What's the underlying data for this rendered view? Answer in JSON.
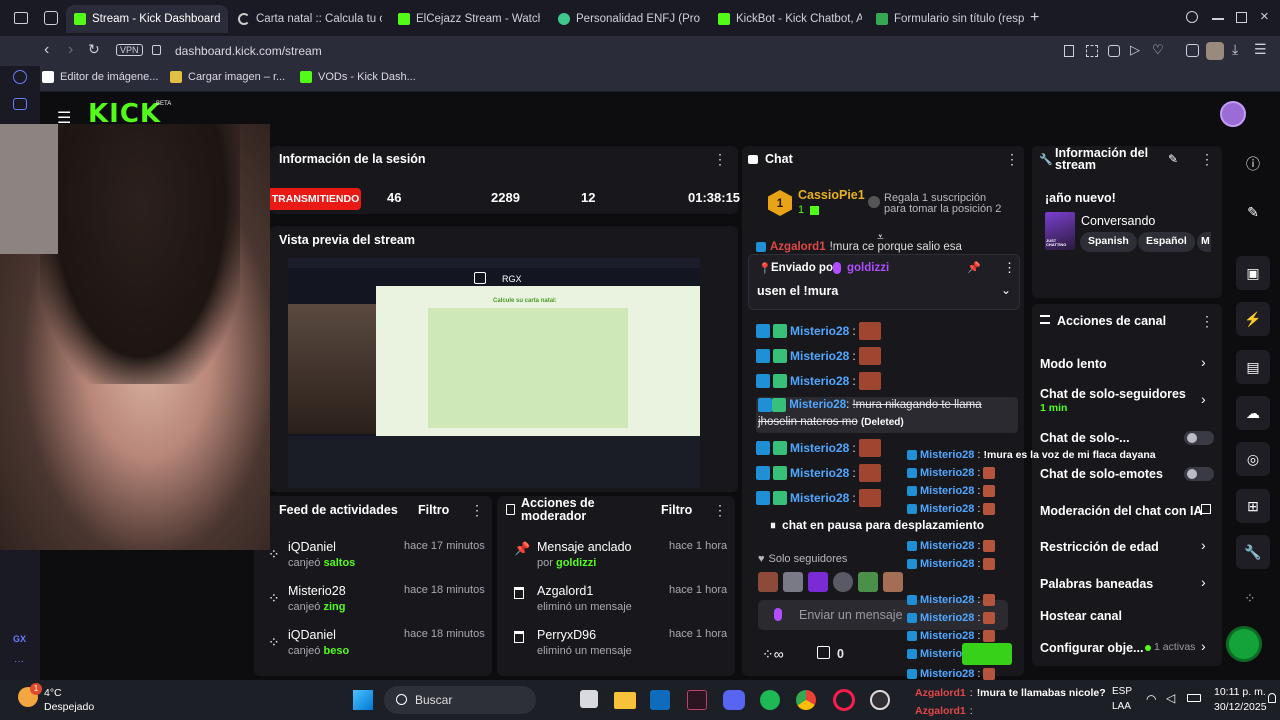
{
  "browser": {
    "tabs": [
      {
        "label": "Stream - Kick Dashboard",
        "active": true,
        "color": "#53fc18"
      },
      {
        "label": "Carta natal :: Calcula tu ca",
        "active": false,
        "color": "#cccccc"
      },
      {
        "label": "ElCejazz Stream - Watch L",
        "active": false,
        "color": "#53fc18"
      },
      {
        "label": "Personalidad ENFJ (Protag",
        "active": false,
        "color": "#3ec98d"
      },
      {
        "label": "KickBot - Kick Chatbot, AI",
        "active": false,
        "color": "#53fc18"
      },
      {
        "label": "Formulario sin título (respu",
        "active": false,
        "color": "#34a853"
      }
    ],
    "vpn": "VPN",
    "url": "dashboard.kick.com/stream",
    "bookmarks": [
      {
        "label": "Editor de imágene...",
        "color": "#ffffff"
      },
      {
        "label": "Cargar imagen – r...",
        "color": "#e0c040"
      },
      {
        "label": "VODs - Kick Dash...",
        "color": "#53fc18"
      }
    ]
  },
  "kick": {
    "logo": "KICK",
    "logo_sup": "BETA"
  },
  "session": {
    "title": "Información de la sesión",
    "status": "TRANSMITIENDO",
    "viewers": "46",
    "followers": "2289",
    "subs": "12",
    "uptime": "01:38:15"
  },
  "preview": {
    "title": "Vista previa del stream",
    "rgx": "RGX",
    "form_title": "Calcule su carta natal:"
  },
  "activity_feed": {
    "title": "Feed de actividades",
    "filter": "Filtro",
    "items": [
      {
        "name": "iQDaniel",
        "action": "canjeó",
        "reward": "saltos",
        "time": "hace 17 minutos"
      },
      {
        "name": "Misterio28",
        "action": "canjeó",
        "reward": "zing",
        "time": "hace 18 minutos"
      },
      {
        "name": "iQDaniel",
        "action": "canjeó",
        "reward": "beso",
        "time": "hace 18 minutos"
      }
    ]
  },
  "mod_actions": {
    "title": "Acciones de moderador",
    "filter": "Filtro",
    "items": [
      {
        "name": "Mensaje anclado",
        "sub_prefix": "por",
        "sub_user": "goldizzi",
        "time": "hace 1 hora",
        "icon": "pin-icon"
      },
      {
        "name": "Azgalord1",
        "sub": "eliminó un mensaje",
        "time": "hace 1 hora",
        "icon": "trash-icon"
      },
      {
        "name": "PerryxD96",
        "sub": "eliminó un mensaje",
        "time": "hace 1 hora",
        "icon": "trash-icon"
      }
    ]
  },
  "chat": {
    "title": "Chat",
    "top_user": "CassioPie1",
    "top_rank": "1",
    "top_count": "1",
    "gift_prompt_line1": "Regala 1 suscripción",
    "gift_prompt_line2": "para tomar la posición 2",
    "peek_name": "Azgalord1",
    "peek_text": "!mura ce porque salio esa",
    "pinned_by_label": "Enviado por",
    "pinned_by_user": "goldizzi",
    "pinned_text": "usen el !mura",
    "messages": [
      {
        "user": "Misterio28",
        "text": ""
      },
      {
        "user": "Misterio28",
        "text": ""
      },
      {
        "user": "Misterio28",
        "text": ""
      },
      {
        "user": "Misterio28",
        "text": "!mura nikagando te llama jhoselin nateros mo",
        "deleted": "(Deleted)"
      },
      {
        "user": "Misterio28",
        "text": ""
      },
      {
        "user": "Misterio28",
        "text": ""
      },
      {
        "user": "Misterio28",
        "text": ""
      }
    ],
    "paused": "chat en pausa para desplazamiento",
    "followers_only": "Solo seguidores",
    "input_placeholder": "Enviar un mensaje",
    "points": "0"
  },
  "overlay_chat": {
    "top_text": "!mura es la voz de mi flaca dayana",
    "user": "Misterio28",
    "bottom_user": "Azgalord1",
    "bottom_text": "!mura te llamabas nicole?"
  },
  "stream_info": {
    "title_line1": "Información del",
    "title_line2": "stream",
    "stream_title": "¡año nuevo!",
    "category": "Conversando",
    "category_thumb": "JUST CHATTING",
    "tags": [
      "Spanish",
      "Español",
      "M"
    ]
  },
  "channel_actions": {
    "title": "Acciones de canal",
    "items": [
      {
        "label": "Modo lento",
        "kind": "chevron"
      },
      {
        "label": "Chat de solo-seguidores",
        "sub": "1 min",
        "kind": "chevron"
      },
      {
        "label": "Chat de solo-...",
        "kind": "toggle"
      },
      {
        "label": "Chat de solo-emotes",
        "kind": "toggle"
      },
      {
        "label": "Moderación del chat con IA",
        "kind": "external"
      },
      {
        "label": "Restricción de edad",
        "kind": "chevron"
      },
      {
        "label": "Palabras baneadas",
        "kind": "chevron"
      },
      {
        "label": "Hostear canal",
        "kind": "none"
      },
      {
        "label": "Configurar obje...",
        "sub": "1 activas",
        "kind": "chevron"
      }
    ]
  },
  "taskbar": {
    "temp": "4°C",
    "weather": "Despejado",
    "weather_badge": "1",
    "search": "Buscar",
    "lang1": "ESP",
    "lang2": "LAA",
    "time": "10:11 p. m.",
    "date": "30/12/2025"
  },
  "left_rail_label": "GX"
}
